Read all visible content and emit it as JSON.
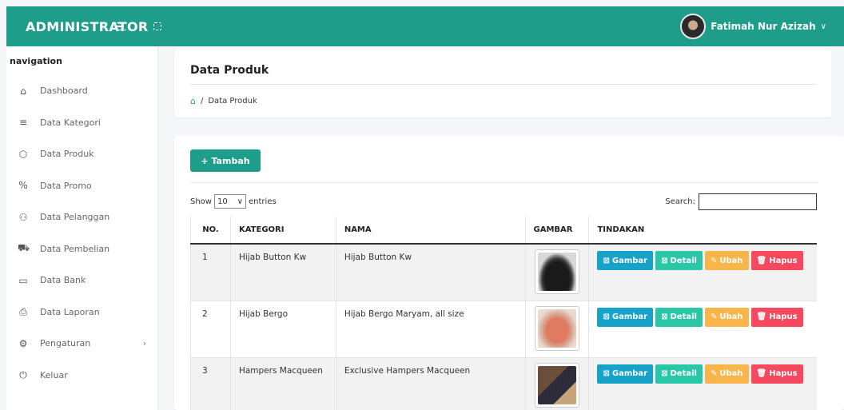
{
  "topbar": {
    "brand": "ADMINISTRATOR",
    "menu_icon": "hamburger-icon",
    "fullscreen_icon": "expand-icon",
    "user_name": "Fatimah Nur Azizah",
    "user_chevron": "∨",
    "bg_color": "#1e9e8a"
  },
  "sidebar": {
    "title": "navigation",
    "items": [
      {
        "icon": "⌂",
        "icon_name": "home-icon",
        "label": "Dashboard"
      },
      {
        "icon": "≡",
        "icon_name": "list-icon",
        "label": "Data Kategori"
      },
      {
        "icon": "⬡",
        "icon_name": "box-icon",
        "label": "Data Produk"
      },
      {
        "icon": "%",
        "icon_name": "percent-icon",
        "label": "Data Promo"
      },
      {
        "icon": "⚇",
        "icon_name": "users-icon",
        "label": "Data Pelanggan"
      },
      {
        "icon": "⛟",
        "icon_name": "cart-icon",
        "label": "Data Pembelian"
      },
      {
        "icon": "▭",
        "icon_name": "card-icon",
        "label": "Data Bank"
      },
      {
        "icon": "⎙",
        "icon_name": "printer-icon",
        "label": "Data Laporan"
      },
      {
        "icon": "⚙",
        "icon_name": "gear-icon",
        "label": "Pengaturan",
        "arrow": "›"
      },
      {
        "icon": "⏻",
        "icon_name": "power-icon",
        "label": "Keluar"
      }
    ]
  },
  "header": {
    "title": "Data Produk",
    "breadcrumb_sep": "/",
    "breadcrumb_current": "Data Produk"
  },
  "toolbar": {
    "add_label": "+ Tambah",
    "show_label": "Show",
    "entries_value": "10",
    "entries_label": "entries",
    "search_label": "Search:",
    "search_value": ""
  },
  "table": {
    "columns": [
      "NO.",
      "KATEGORI",
      "NAMA",
      "GAMBAR",
      "TINDAKAN"
    ],
    "rows": [
      {
        "no": "1",
        "kategori": "Hijab Button Kw",
        "nama": "Hijab Button Kw",
        "gambar": "black-hijab-photo"
      },
      {
        "no": "2",
        "kategori": "Hijab Bergo",
        "nama": "Hijab Bergo Maryam, all size",
        "gambar": "peach-hijab-photo"
      },
      {
        "no": "3",
        "kategori": "Hampers Macqueen",
        "nama": "Exclusive Hampers Macqueen",
        "gambar": "hampers-box-photo"
      }
    ],
    "actions": {
      "gambar": "Gambar",
      "detail": "Detail",
      "ubah": "Ubah",
      "hapus": "Hapus"
    }
  },
  "colors": {
    "primary": "#1e9e8a",
    "info": "#17a2c9",
    "detail": "#29c7a7",
    "warning": "#f8b64a",
    "danger": "#f4495e"
  }
}
